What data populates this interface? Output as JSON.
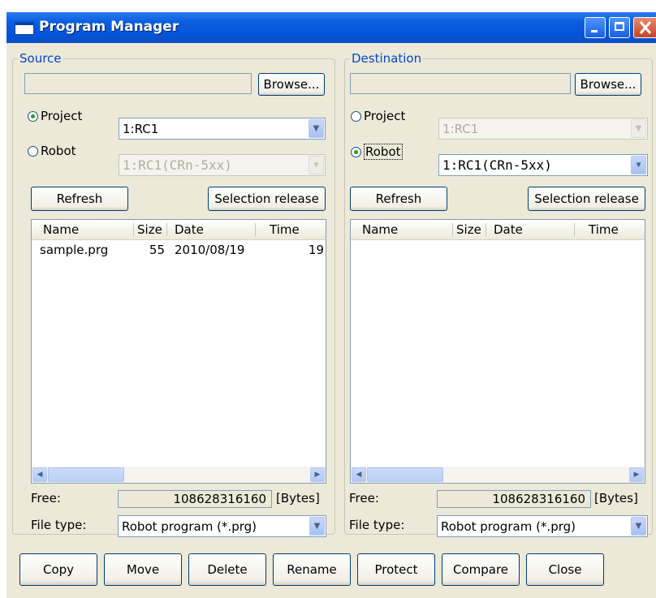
{
  "window": {
    "title": "Program Manager"
  },
  "source": {
    "legend": "Source",
    "path_value": "",
    "browse_label": "Browse...",
    "project_label": "Project",
    "project_selected": true,
    "project_value": "1:RC1",
    "robot_label": "Robot",
    "robot_selected": false,
    "robot_value": "1:RC1(CRn-5xx)",
    "refresh_label": "Refresh",
    "selection_release_label": "Selection release",
    "columns": [
      "Name",
      "Size",
      "Date",
      "Time"
    ],
    "rows": [
      {
        "name": "sample.prg",
        "size": "55",
        "date": "2010/08/19",
        "time": "19"
      }
    ],
    "free_label": "Free:",
    "free_value": "108628316160",
    "bytes_label": "[Bytes]",
    "file_type_label": "File type:",
    "file_type_value": "Robot program (*.prg)"
  },
  "destination": {
    "legend": "Destination",
    "path_value": "",
    "browse_label": "Browse...",
    "project_label": "Project",
    "project_selected": false,
    "project_value": "1:RC1",
    "robot_label": "Robot",
    "robot_selected": true,
    "robot_value": "1:RC1(CRn-5xx)",
    "refresh_label": "Refresh",
    "selection_release_label": "Selection release",
    "columns": [
      "Name",
      "Size",
      "Date",
      "Time"
    ],
    "rows": [],
    "free_label": "Free:",
    "free_value": "108628316160",
    "bytes_label": "[Bytes]",
    "file_type_label": "File type:",
    "file_type_value": "Robot program (*.prg)"
  },
  "actions": {
    "copy": "Copy",
    "move": "Move",
    "delete": "Delete",
    "rename": "Rename",
    "protect": "Protect",
    "compare": "Compare",
    "close": "Close"
  },
  "colors": {
    "titlebar": "#0554D8",
    "legend": "#0046D5",
    "face": "#ECE9D8"
  },
  "icons": {
    "app": "window-icon",
    "minimize": "minimize-icon",
    "maximize": "maximize-icon",
    "close": "close-icon"
  }
}
